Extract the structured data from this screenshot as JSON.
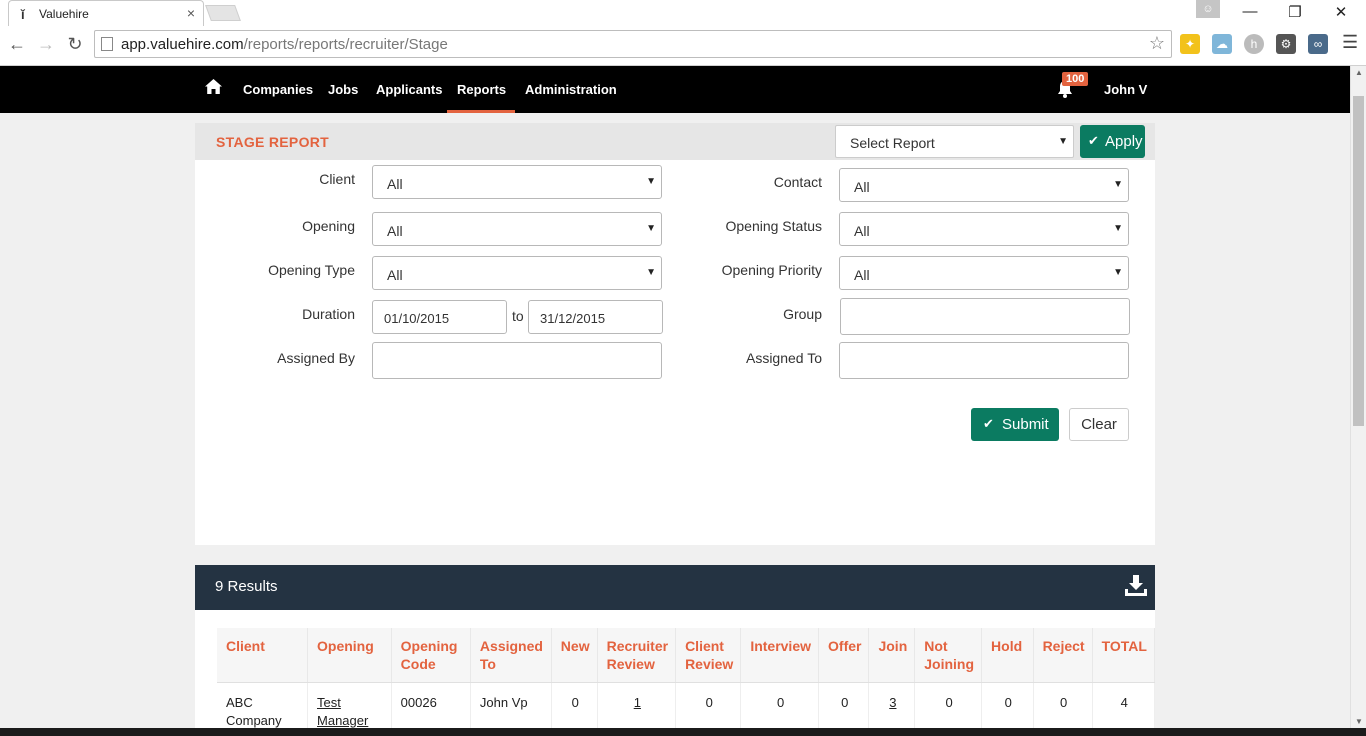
{
  "browser": {
    "tab_title": "Valuehire",
    "url_host": "app.valuehire.com",
    "url_path": "/reports/reports/recruiter/Stage"
  },
  "nav": {
    "items": [
      "Companies",
      "Jobs",
      "Applicants",
      "Reports",
      "Administration"
    ],
    "active": "Reports",
    "notification_count": "100",
    "user_name": "John V"
  },
  "report": {
    "title": "STAGE REPORT",
    "select_report": "Select Report",
    "apply_label": "Apply",
    "fields": {
      "client_label": "Client",
      "client_value": "All",
      "contact_label": "Contact",
      "contact_value": "All",
      "opening_label": "Opening",
      "opening_value": "All",
      "opening_status_label": "Opening Status",
      "opening_status_value": "All",
      "opening_type_label": "Opening Type",
      "opening_type_value": "All",
      "opening_priority_label": "Opening Priority",
      "opening_priority_value": "All",
      "duration_label": "Duration",
      "duration_from": "01/10/2015",
      "duration_to_label": "to",
      "duration_to": "31/12/2015",
      "group_label": "Group",
      "group_value": "",
      "assigned_by_label": "Assigned By",
      "assigned_by_value": "",
      "assigned_to_label": "Assigned To",
      "assigned_to_value": ""
    },
    "submit_label": "Submit",
    "clear_label": "Clear"
  },
  "results": {
    "count_label": "9 Results",
    "columns": [
      "Client",
      "Opening",
      "Opening Code",
      "Assigned To",
      "New",
      "Recruiter Review",
      "Client Review",
      "Interview",
      "Offer",
      "Join",
      "Not Joining",
      "Hold",
      "Reject",
      "TOTAL"
    ],
    "rows": [
      {
        "client": "ABC Company",
        "opening": "Test Manager",
        "opening_code": "00026",
        "assigned_to": "John Vp",
        "new": "0",
        "recruiter_review": "1",
        "client_review": "0",
        "interview": "0",
        "offer": "0",
        "join": "3",
        "not_joining": "0",
        "hold": "0",
        "reject": "0",
        "total": "4"
      }
    ]
  },
  "colors": {
    "accent": "#e3633f",
    "navbar": "#000000",
    "primary_button": "#0b7b61",
    "results_header": "#243342"
  }
}
